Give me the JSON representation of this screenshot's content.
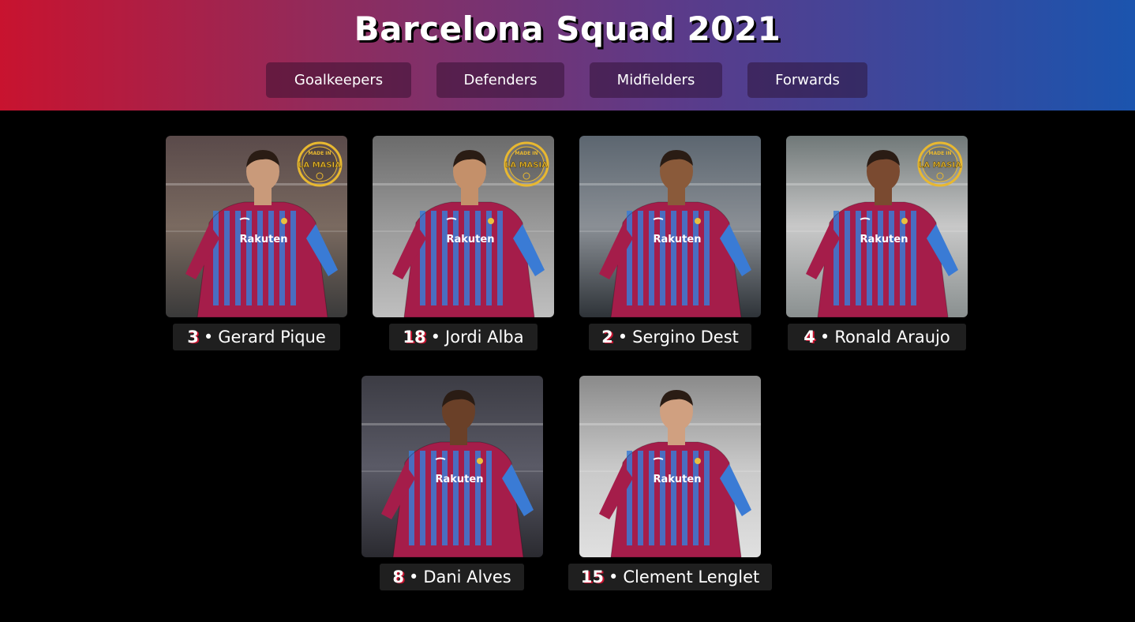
{
  "page": {
    "title": "Barcelona Squad 2021"
  },
  "nav": {
    "items": [
      "Goalkeepers",
      "Defenders",
      "Midfielders",
      "Forwards"
    ]
  },
  "badge": {
    "top_text": "MADE IN",
    "main_text": "LA MASIA"
  },
  "players": [
    {
      "number": "3",
      "sep": "•",
      "name": "Gerard Pique",
      "la_masia": true,
      "sponsor": "Rakuten"
    },
    {
      "number": "18",
      "sep": "•",
      "name": "Jordi Alba",
      "la_masia": true,
      "sponsor": "Rakuten"
    },
    {
      "number": "2",
      "sep": "•",
      "name": "Sergino Dest",
      "la_masia": false,
      "sponsor": "Rakuten"
    },
    {
      "number": "4",
      "sep": "•",
      "name": "Ronald Araujo",
      "la_masia": true,
      "sponsor": "Rakuten"
    },
    {
      "number": "8",
      "sep": "•",
      "name": "Dani Alves",
      "la_masia": false,
      "sponsor": "Rakuten"
    },
    {
      "number": "15",
      "sep": "•",
      "name": "Clement Lenglet",
      "la_masia": false,
      "sponsor": "Rakuten"
    }
  ],
  "colors": {
    "header_gradient_start": "#c8132f",
    "header_gradient_end": "#1b54ae",
    "blaugrana_red": "#a51d4a",
    "blaugrana_blue": "#3a7bd5",
    "badge_gold": "#e8b830"
  }
}
